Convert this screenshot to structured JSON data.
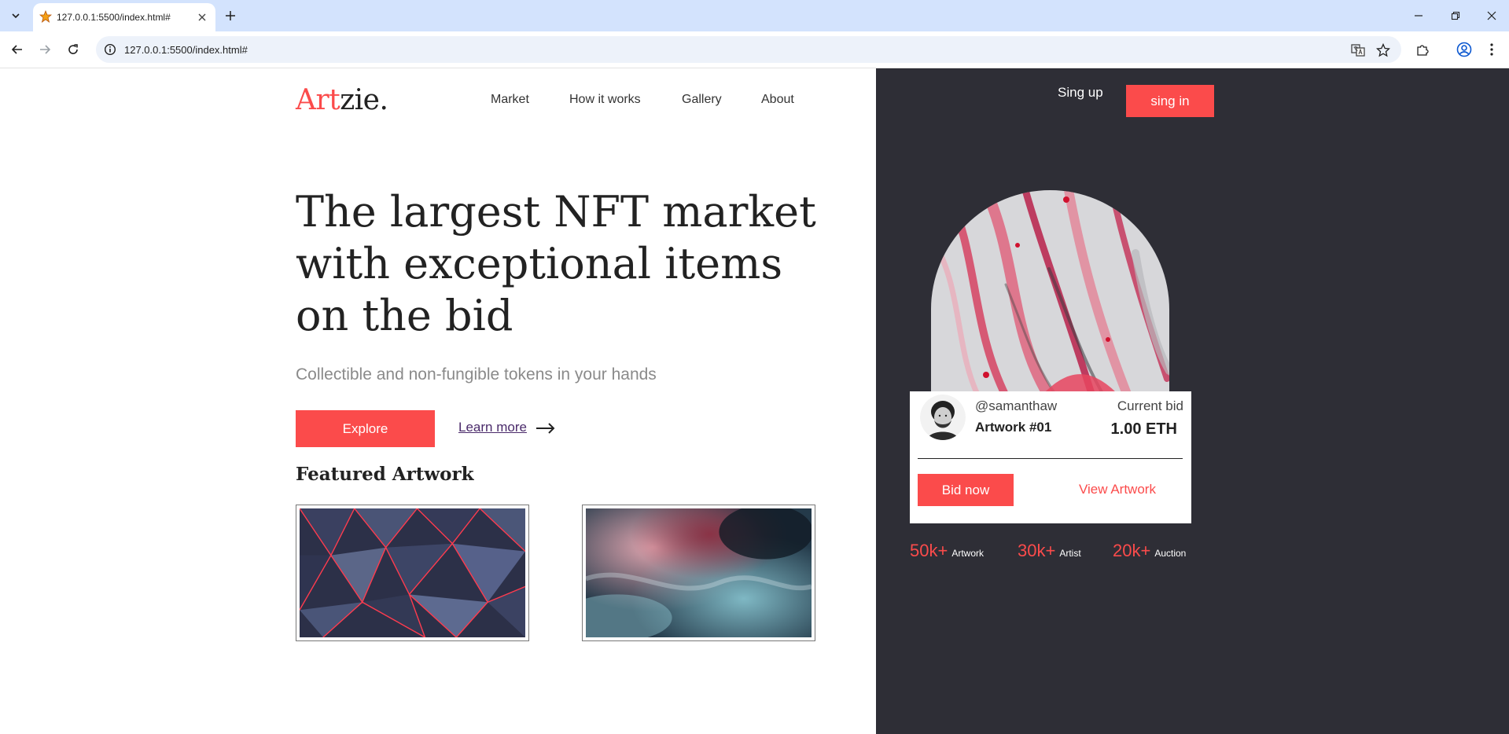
{
  "browser": {
    "tab_title": "127.0.0.1:5500/index.html#",
    "url": "127.0.0.1:5500/index.html#"
  },
  "site": {
    "logo_accent": "Art",
    "logo_rest": "zie.",
    "nav": [
      "Market",
      "How it works",
      "Gallery",
      "About"
    ],
    "signup": "Sing up",
    "signin": "sing in"
  },
  "hero": {
    "title": "The largest NFT market with exceptional items on the bid",
    "subtitle": "Collectible and non-fungible tokens in your hands",
    "explore": "Explore",
    "learn_more": "Learn more"
  },
  "featured": {
    "title": "Featured Artwork"
  },
  "bid_card": {
    "username": "@samanthaw",
    "artwork": "Artwork #01",
    "current_bid_label": "Current bid",
    "current_bid_value": "1.00 ETH",
    "bid_now": "Bid now",
    "view_artwork": "View Artwork"
  },
  "stats": [
    {
      "value": "50k+",
      "label": "Artwork"
    },
    {
      "value": "30k+",
      "label": "Artist"
    },
    {
      "value": "20k+",
      "label": "Auction"
    }
  ],
  "colors": {
    "accent": "#fb4b4b",
    "dark_panel": "#2e2e36",
    "chrome_bar": "#d3e3fd"
  }
}
